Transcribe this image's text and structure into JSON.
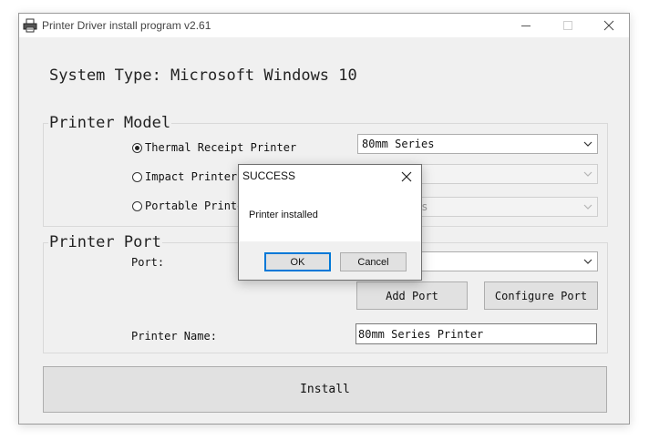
{
  "window": {
    "title": "Printer Driver install program v2.61",
    "app_icon": "printer-icon",
    "controls": [
      "minimize-icon",
      "maximize-icon",
      "close-icon"
    ]
  },
  "system_type": "System Type: Microsoft Windows 10",
  "printer_model": {
    "group_title": "Printer Model",
    "options": [
      {
        "label": "Thermal Receipt Printer",
        "checked": true,
        "combo_value": "80mm Series",
        "combo_enabled": true
      },
      {
        "label": "Impact Printer",
        "checked": false,
        "combo_value": "",
        "combo_enabled": false
      },
      {
        "label": "Portable Printer",
        "checked": false,
        "combo_value": "es",
        "combo_enabled": false
      }
    ]
  },
  "printer_port": {
    "group_title": "Printer Port",
    "port_label": "Port:",
    "port_value": "",
    "add_port_label": "Add Port",
    "configure_port_label": "Configure Port",
    "printer_name_label": "Printer Name:",
    "printer_name_value": "80mm Series Printer"
  },
  "install_label": "Install",
  "dialog": {
    "title": "SUCCESS",
    "message": "Printer installed",
    "ok_label": "OK",
    "cancel_label": "Cancel"
  },
  "colors": {
    "window_bg": "#f0f0f0",
    "default_button_border": "#0078d7"
  }
}
